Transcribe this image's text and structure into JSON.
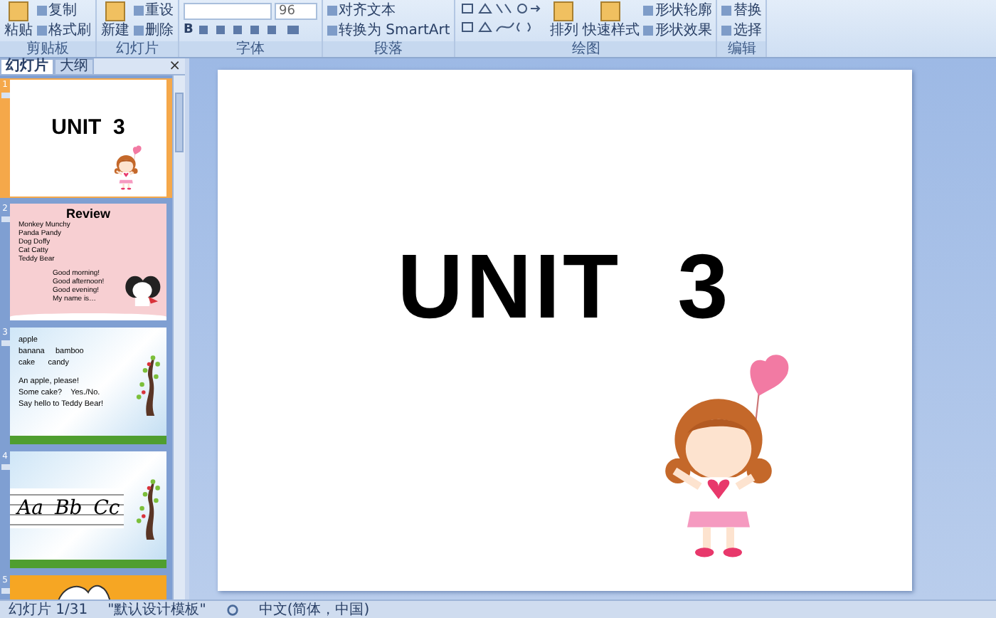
{
  "ribbon": {
    "groups": [
      {
        "label": "剪贴板",
        "items": [
          {
            "kind": "big",
            "label": "粘贴"
          },
          {
            "kind": "small",
            "label": "复制"
          },
          {
            "kind": "small",
            "label": "格式刷"
          }
        ]
      },
      {
        "label": "幻灯片",
        "items": [
          {
            "kind": "big",
            "label": "新建"
          },
          {
            "kind": "small",
            "label": "重设"
          },
          {
            "kind": "small",
            "label": "删除"
          }
        ]
      },
      {
        "label": "字体",
        "items": [
          {
            "kind": "fontsize",
            "label": "96"
          },
          {
            "kind": "fontbar",
            "label": "B"
          }
        ]
      },
      {
        "label": "段落",
        "items": [
          {
            "kind": "small",
            "label": "对齐文本"
          },
          {
            "kind": "small",
            "label": "转换为 SmartArt"
          }
        ]
      },
      {
        "label": "绘图",
        "items": [
          {
            "kind": "shapes"
          },
          {
            "kind": "big",
            "label": "排列"
          },
          {
            "kind": "big",
            "label": "快速样式"
          },
          {
            "kind": "small",
            "label": "形状轮廓"
          },
          {
            "kind": "small",
            "label": "形状效果"
          }
        ]
      },
      {
        "label": "编辑",
        "items": [
          {
            "kind": "small",
            "label": "替换"
          },
          {
            "kind": "small",
            "label": "选择"
          }
        ]
      }
    ]
  },
  "panel": {
    "tabs": [
      {
        "label": "幻灯片",
        "selected": true
      },
      {
        "label": "大纲",
        "selected": false
      }
    ],
    "close": "×"
  },
  "thumbnails": [
    {
      "number": "1",
      "selected": true,
      "kind": "title",
      "title": "UNIT  3"
    },
    {
      "number": "2",
      "selected": false,
      "kind": "review",
      "title": "Review",
      "lines": [
        "Monkey Munchy",
        "Panda Pandy",
        "Dog  Doffy",
        "Cat Catty",
        "Teddy Bear"
      ],
      "greetings": [
        "Good morning!",
        "Good afternoon!",
        "Good evening!",
        "My name is…"
      ]
    },
    {
      "number": "3",
      "selected": false,
      "kind": "words",
      "words": [
        "apple",
        "banana     bamboo",
        "cake      candy"
      ],
      "phrases": [
        "An apple, please!",
        "Some cake?    Yes./No.",
        "Say hello to Teddy Bear!"
      ]
    },
    {
      "number": "4",
      "selected": false,
      "kind": "letters",
      "letters": [
        "Aa",
        "Bb",
        "Cc"
      ]
    },
    {
      "number": "5",
      "selected": false,
      "kind": "partial"
    }
  ],
  "slide": {
    "title": "UNIT  3"
  },
  "status_bar": {
    "slide": "幻灯片 1/31",
    "theme": "\"默认设计模板\"",
    "language": "中文(简体，中国)"
  }
}
